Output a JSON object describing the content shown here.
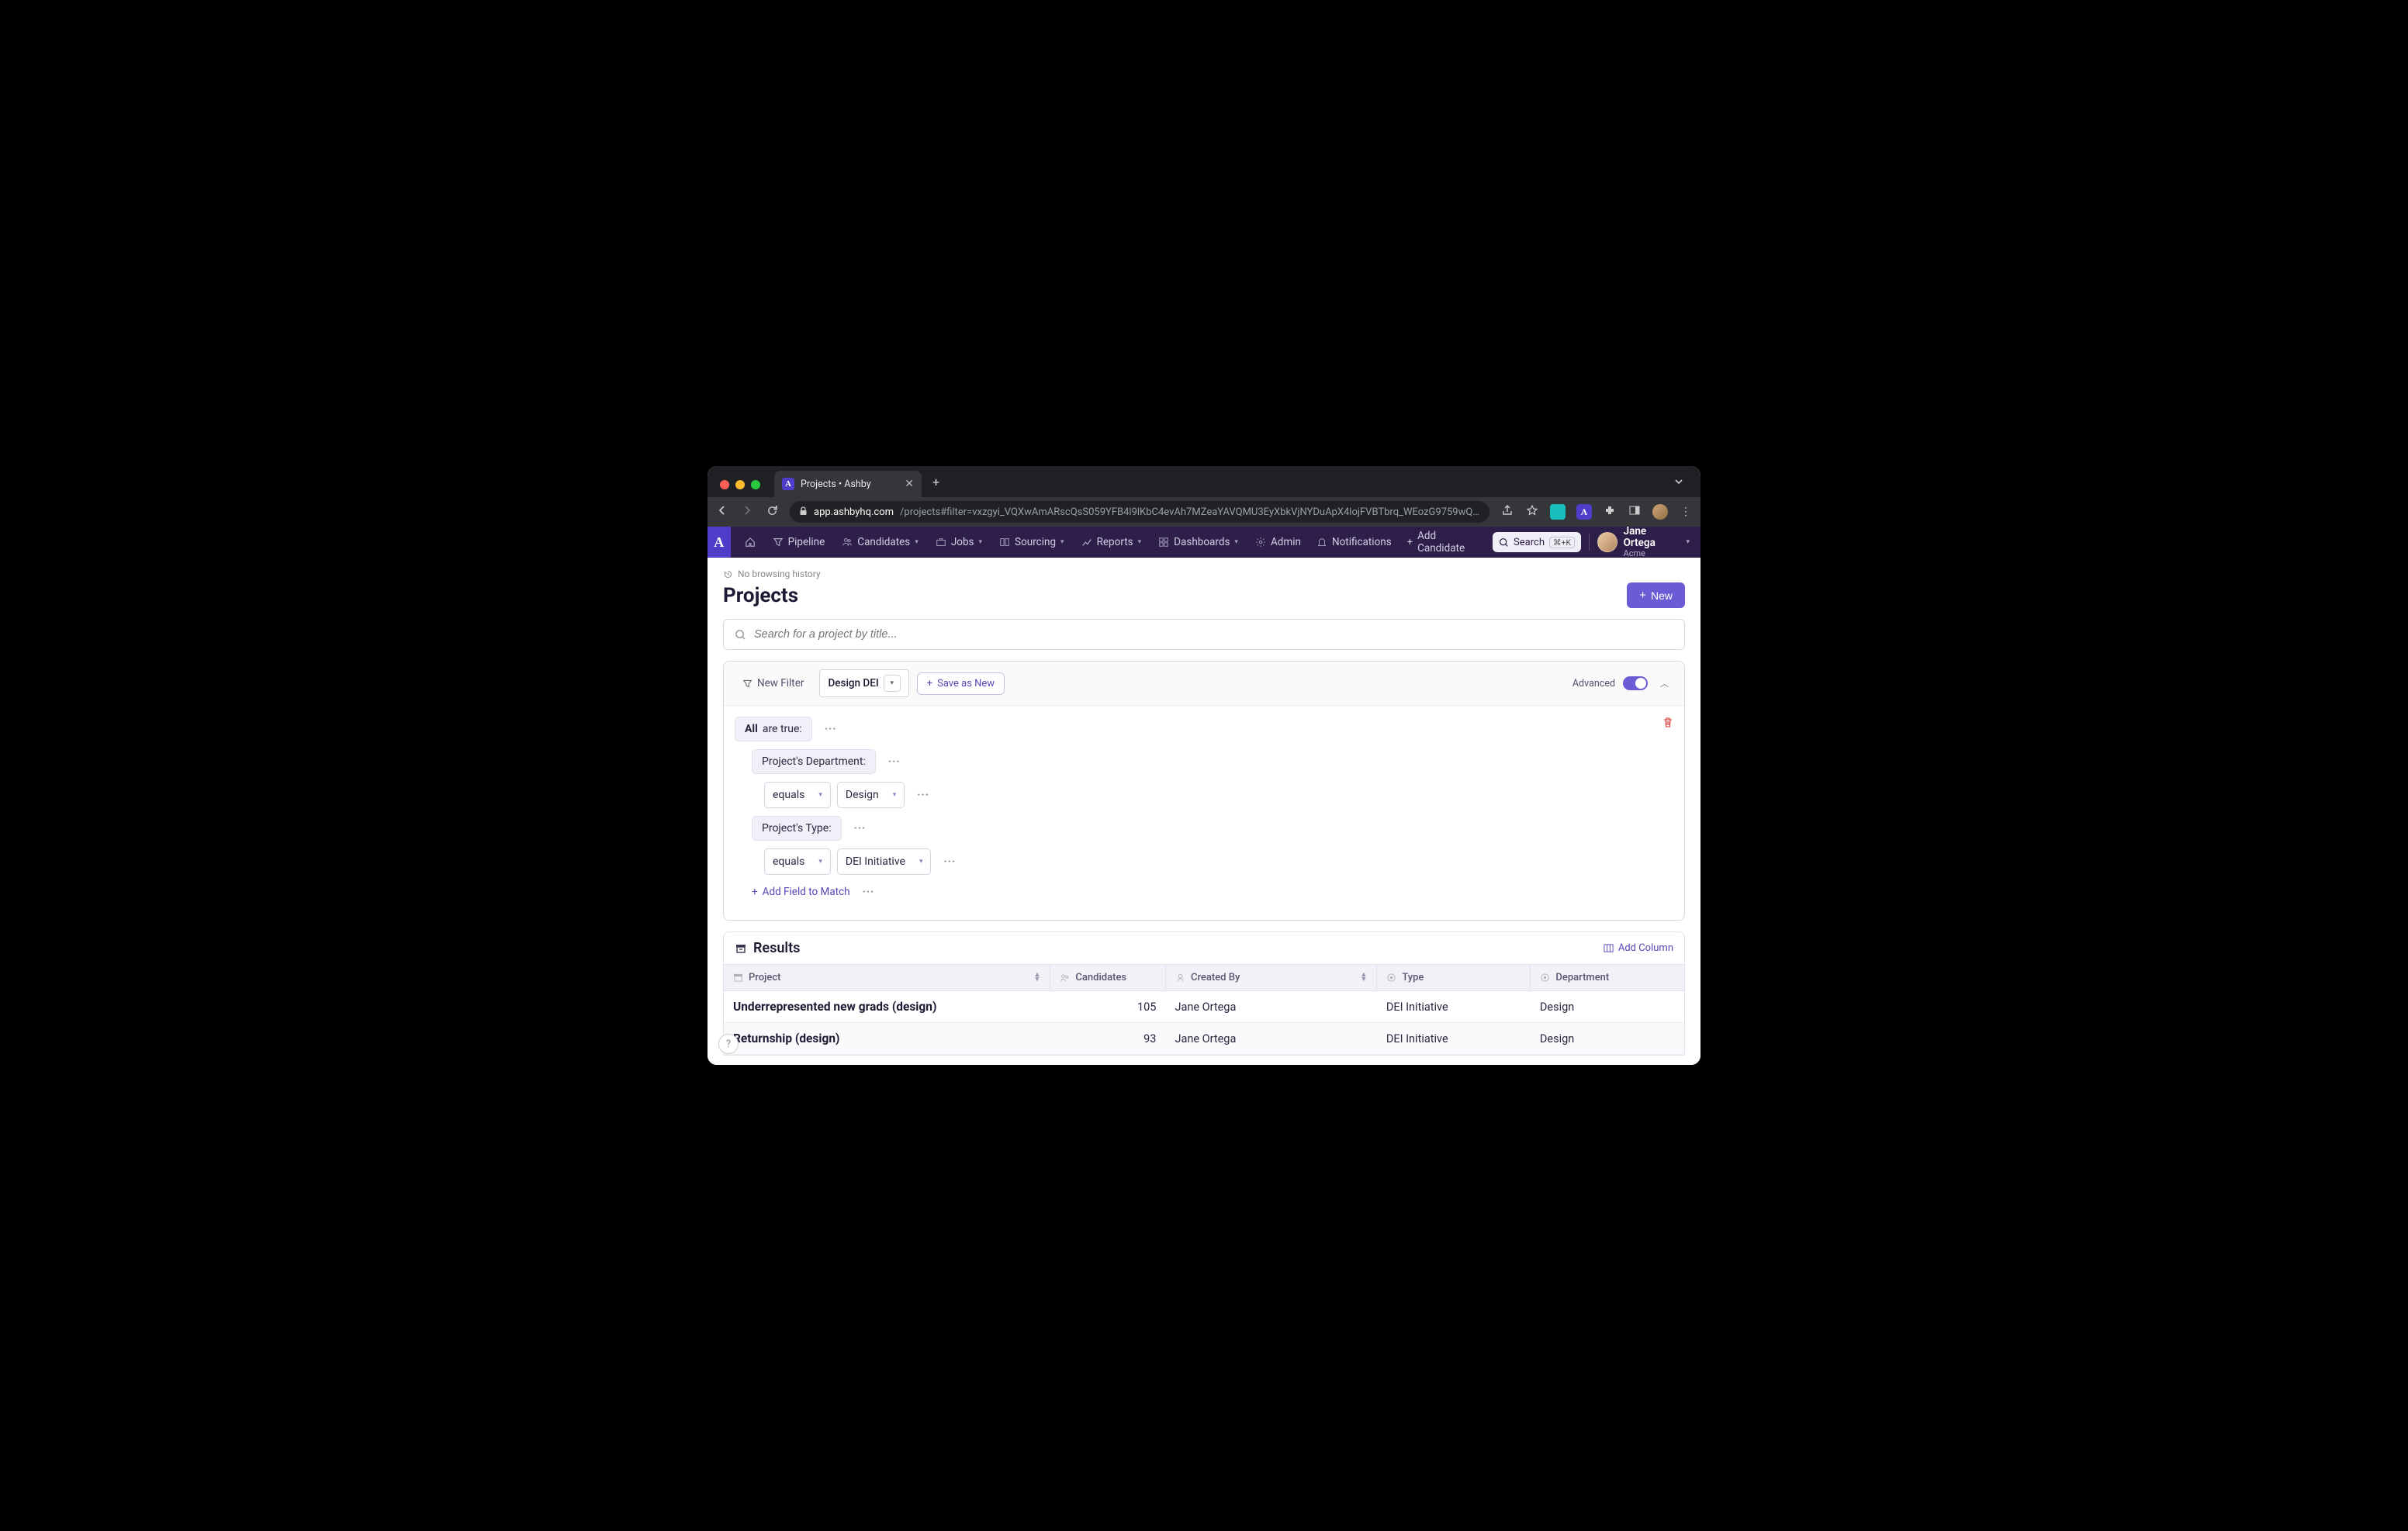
{
  "browser": {
    "tab_title": "Projects • Ashby",
    "url_host": "app.ashbyhq.com",
    "url_path": "/projects#filter=vxzgyi_VQXwAmARscQsS059YFB4l9lKbC4evAh7MZeaYAVQMU3EyXbkVjNYDuApX4lojFVBTbrq_WEozG9759wQ3fyiOV..."
  },
  "topnav": {
    "items": [
      {
        "label": "Pipeline"
      },
      {
        "label": "Candidates",
        "dropdown": true
      },
      {
        "label": "Jobs",
        "dropdown": true
      },
      {
        "label": "Sourcing",
        "dropdown": true
      },
      {
        "label": "Reports",
        "dropdown": true
      },
      {
        "label": "Dashboards",
        "dropdown": true
      },
      {
        "label": "Admin"
      }
    ],
    "notifications": "Notifications",
    "add_candidate": "Add Candidate",
    "search": "Search",
    "search_kbd": "⌘+K",
    "user_name": "Jane Ortega",
    "user_company": "Acme"
  },
  "breadcrumb": "No browsing history",
  "page_title": "Projects",
  "new_button": "New",
  "search_placeholder": "Search for a project by title...",
  "filter": {
    "new_filter": "New Filter",
    "active_name": "Design DEI",
    "save_as_new": "Save as New",
    "advanced_label": "Advanced",
    "group_prefix": "All",
    "group_suffix": " are true:",
    "dept_label": "Project's Department:",
    "dept_op": "equals",
    "dept_val": "Design",
    "type_label": "Project's Type:",
    "type_op": "equals",
    "type_val": "DEI Initiative",
    "add_field": "Add Field to Match"
  },
  "results": {
    "title": "Results",
    "add_column": "Add Column",
    "columns": {
      "project": "Project",
      "candidates": "Candidates",
      "created_by": "Created By",
      "type": "Type",
      "department": "Department"
    },
    "rows": [
      {
        "project": "Underrepresented new grads (design)",
        "candidates": "105",
        "created_by": "Jane Ortega",
        "type": "DEI Initiative",
        "department": "Design"
      },
      {
        "project": "Returnship (design)",
        "candidates": "93",
        "created_by": "Jane Ortega",
        "type": "DEI Initiative",
        "department": "Design"
      }
    ]
  }
}
